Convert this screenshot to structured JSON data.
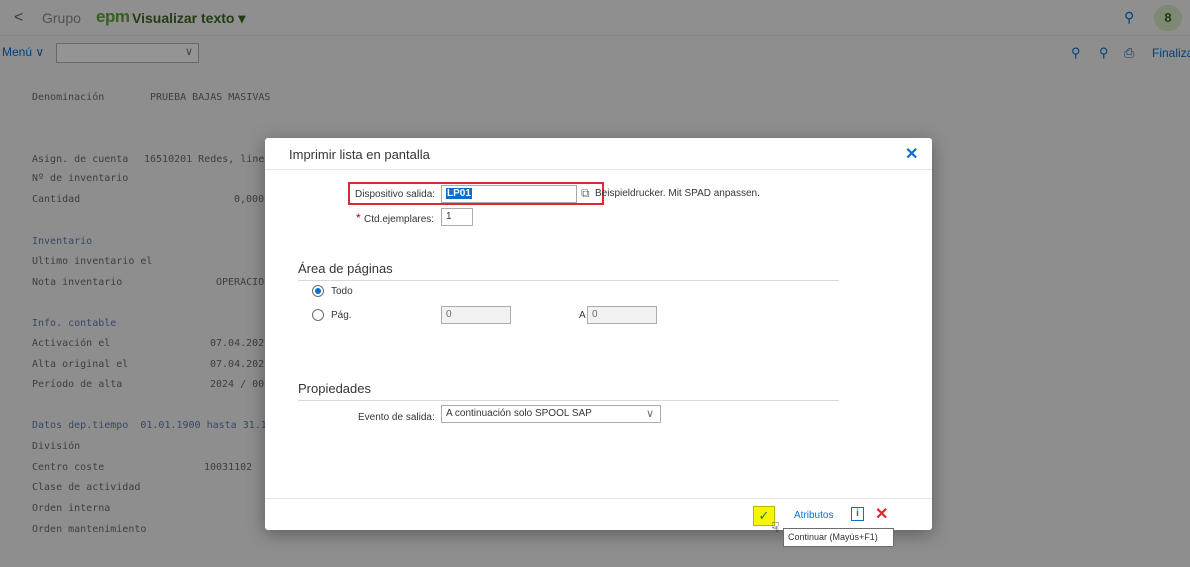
{
  "shell": {
    "back_icon": "back-chevron-icon",
    "grupo": "Grupo",
    "brand": "epm",
    "title": "Visualizar texto ▾",
    "user_initial": "8"
  },
  "toolbar": {
    "menu_label": "Menú ∨",
    "select_value": "",
    "finalizar": "Finalizar"
  },
  "background": {
    "denominacion_label": "Denominación",
    "denominacion_value": "PRUEBA BAJAS MASIVAS",
    "asign_label": "Asign. de cuenta",
    "asign_value": "16510201 Redes, line",
    "inventario_no_label": "Nº de inventario",
    "cantidad_label": "Cantidad",
    "cantidad_value": "0,000",
    "inventario_section": "Inventario",
    "ultimo_label": "Ultimo inventario el",
    "nota_label": "Nota inventario",
    "nota_value": "OPERACIO",
    "info_section": "Info. contable",
    "activacion_label": "Activación el",
    "activacion_value": "07.04.202",
    "alta_label": "Alta original el",
    "alta_value": "07.04.202",
    "periodo_label": "Período de alta",
    "periodo_value": "2024 / 00",
    "datos_section": "Datos dep.tiempo  01.01.1900 hasta 31.1",
    "division_label": "División",
    "centro_label": "Centro coste",
    "centro_value": "10031102",
    "clase_label": "Clase de actividad",
    "orden_int_label": "Orden interna",
    "orden_mant_label": "Orden mantenimiento"
  },
  "dialog": {
    "title": "Imprimir lista en pantalla",
    "dispositivo_label": "Dispositivo salida:",
    "dispositivo_value": "LP01",
    "dispositivo_desc": "Beispieldrucker. Mit SPAD anpassen.",
    "ctd_label": "Ctd.ejemplares:",
    "ctd_value": "1",
    "area_section": "Área de páginas",
    "todo_label": "Todo",
    "pag_label": "Pág.",
    "pag_from": "0",
    "pag_to_label": "A",
    "pag_to": "0",
    "propiedades_section": "Propiedades",
    "evento_label": "Evento de salida:",
    "evento_value": "A continuación solo SPOOL SAP",
    "attributes_link": "Atributos",
    "tooltip": "Continuar (Mayús+F1)"
  }
}
